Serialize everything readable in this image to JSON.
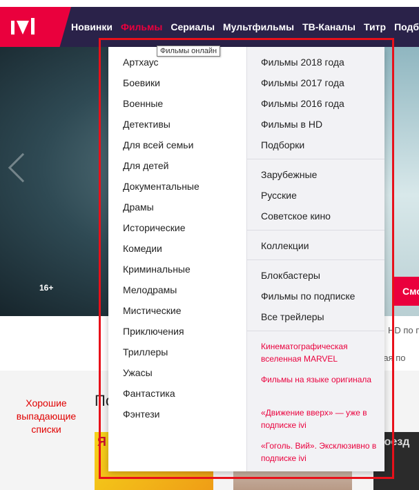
{
  "header": {
    "nav": [
      "Новинки",
      "Фильмы",
      "Сериалы",
      "Мультфильмы",
      "ТВ-Каналы",
      "Титр",
      "Подб"
    ],
    "active_index": 1
  },
  "tooltip": "Фильмы онлайн",
  "hero": {
    "age_rating": "16+",
    "watch_button": "Смо"
  },
  "behind_text": [
    "HD по п",
    "нная по"
  ],
  "note": "Хорошие выпадающие списки",
  "section_heading_partial": "По",
  "poster_texts": [
    "Я",
    "поезд"
  ],
  "dropdown": {
    "genres": [
      "Артхаус",
      "Боевики",
      "Военные",
      "Детективы",
      "Для всей семьи",
      "Для детей",
      "Документальные",
      "Драмы",
      "Исторические",
      "Комедии",
      "Криминальные",
      "Мелодрамы",
      "Мистические",
      "Приключения",
      "Триллеры",
      "Ужасы",
      "Фантастика",
      "Фэнтези"
    ],
    "groups": [
      [
        "Фильмы 2018 года",
        "Фильмы 2017 года",
        "Фильмы 2016 года",
        "Фильмы в HD",
        "Подборки"
      ],
      [
        "Зарубежные",
        "Русские",
        "Советское кино"
      ],
      [
        "Коллекции"
      ],
      [
        "Блокбастеры",
        "Фильмы по подписке",
        "Все трейлеры"
      ]
    ],
    "promos": [
      "Кинематографическая вселенная MARVEL",
      "Фильмы на языке оригинала",
      "«Движение вверх» — уже в подписке ivi",
      "«Гоголь. Вий». Эксклюзивно в подписке ivi"
    ]
  },
  "colors": {
    "brand": "#ea003d",
    "nav_bg": "#2a2249",
    "highlight": "#e8101a"
  }
}
